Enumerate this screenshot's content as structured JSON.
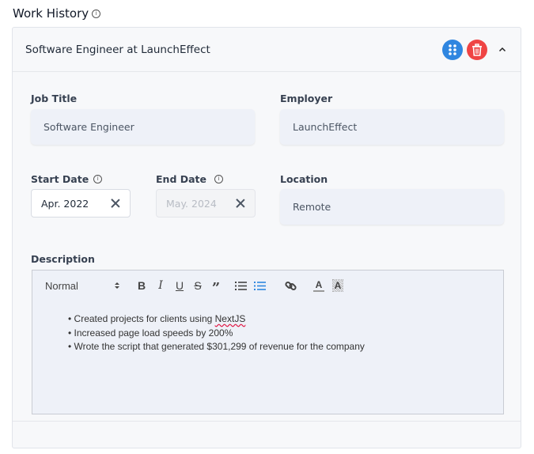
{
  "section": {
    "title": "Work History",
    "info_icon": "info-circle-icon"
  },
  "entry": {
    "header_title": "Software Engineer at LaunchEffect",
    "actions": {
      "drag": "drag-handle-icon",
      "delete": "trash-icon",
      "collapse": "chevron-up-icon"
    },
    "job_title": {
      "label": "Job Title",
      "value": "Software Engineer"
    },
    "employer": {
      "label": "Employer",
      "value": "LaunchEffect"
    },
    "start_date": {
      "label": "Start Date",
      "value": "Apr. 2022"
    },
    "end_date": {
      "label": "End Date",
      "placeholder": "May. 2024"
    },
    "location": {
      "label": "Location",
      "value": "Remote"
    },
    "description": {
      "label": "Description",
      "toolbar": {
        "format_select": "Normal",
        "buttons": [
          "bold",
          "italic",
          "underline",
          "strike",
          "blockquote",
          "ordered-list",
          "bullet-list",
          "link",
          "text-color",
          "background-color"
        ]
      },
      "bullets": [
        {
          "pre": "Created projects for clients using ",
          "flagged": "NextJS",
          "post": ""
        },
        {
          "pre": "Increased page load speeds by 200%",
          "flagged": "",
          "post": ""
        },
        {
          "pre": "Wrote the script that generated $301,299 of revenue for the company",
          "flagged": "",
          "post": ""
        }
      ]
    }
  },
  "colors": {
    "accent": "#2f86e0",
    "danger": "#ef4444",
    "active_tool": "#2f86e0"
  }
}
